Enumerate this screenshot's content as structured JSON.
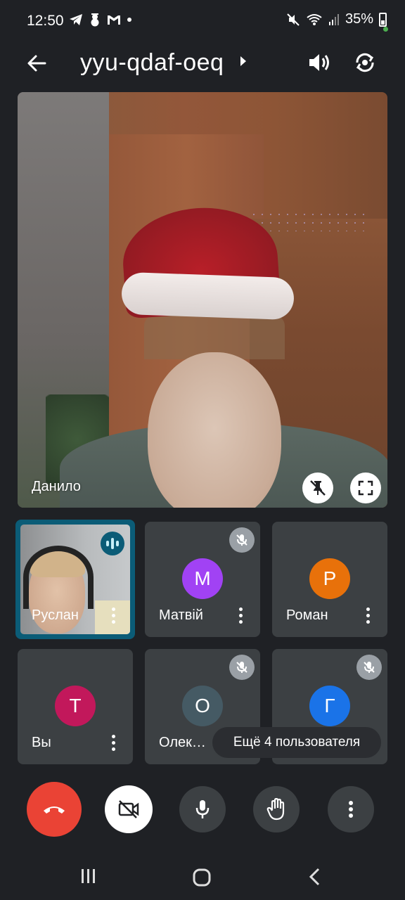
{
  "status_bar": {
    "time": "12:50",
    "battery": "35%",
    "left_icons": [
      "telegram-icon",
      "snowman-icon",
      "gmail-icon",
      "dot-icon"
    ],
    "right_icons": [
      "mute-icon",
      "wifi-icon",
      "signal-icon",
      "battery-icon"
    ]
  },
  "top_bar": {
    "meeting_code": "yyu-qdaf-oeq"
  },
  "main_video": {
    "participant_name": "Данило"
  },
  "tiles": [
    {
      "name": "Руслан",
      "type": "video",
      "speaking": true
    },
    {
      "name": "Матвій",
      "initial": "М",
      "avatar_color": "#a142f4",
      "muted": true
    },
    {
      "name": "Роман",
      "initial": "Р",
      "avatar_color": "#e8710a",
      "muted": false
    },
    {
      "name": "Вы",
      "initial": "Т",
      "avatar_color": "#c2185b",
      "muted": false
    },
    {
      "name": "Олек…",
      "initial": "О",
      "avatar_color": "#455a64",
      "muted": true
    },
    {
      "name": "",
      "initial": "Г",
      "avatar_color": "#1a73e8",
      "muted": true
    }
  ],
  "more_participants": "Ещё 4 пользователя",
  "controls": [
    "end-call",
    "camera-off",
    "microphone",
    "raise-hand",
    "more-options"
  ],
  "colors": {
    "background": "#1f2125",
    "tile": "#3c4043",
    "hangup": "#ea4335",
    "speaking_border": "#0b5c77"
  }
}
